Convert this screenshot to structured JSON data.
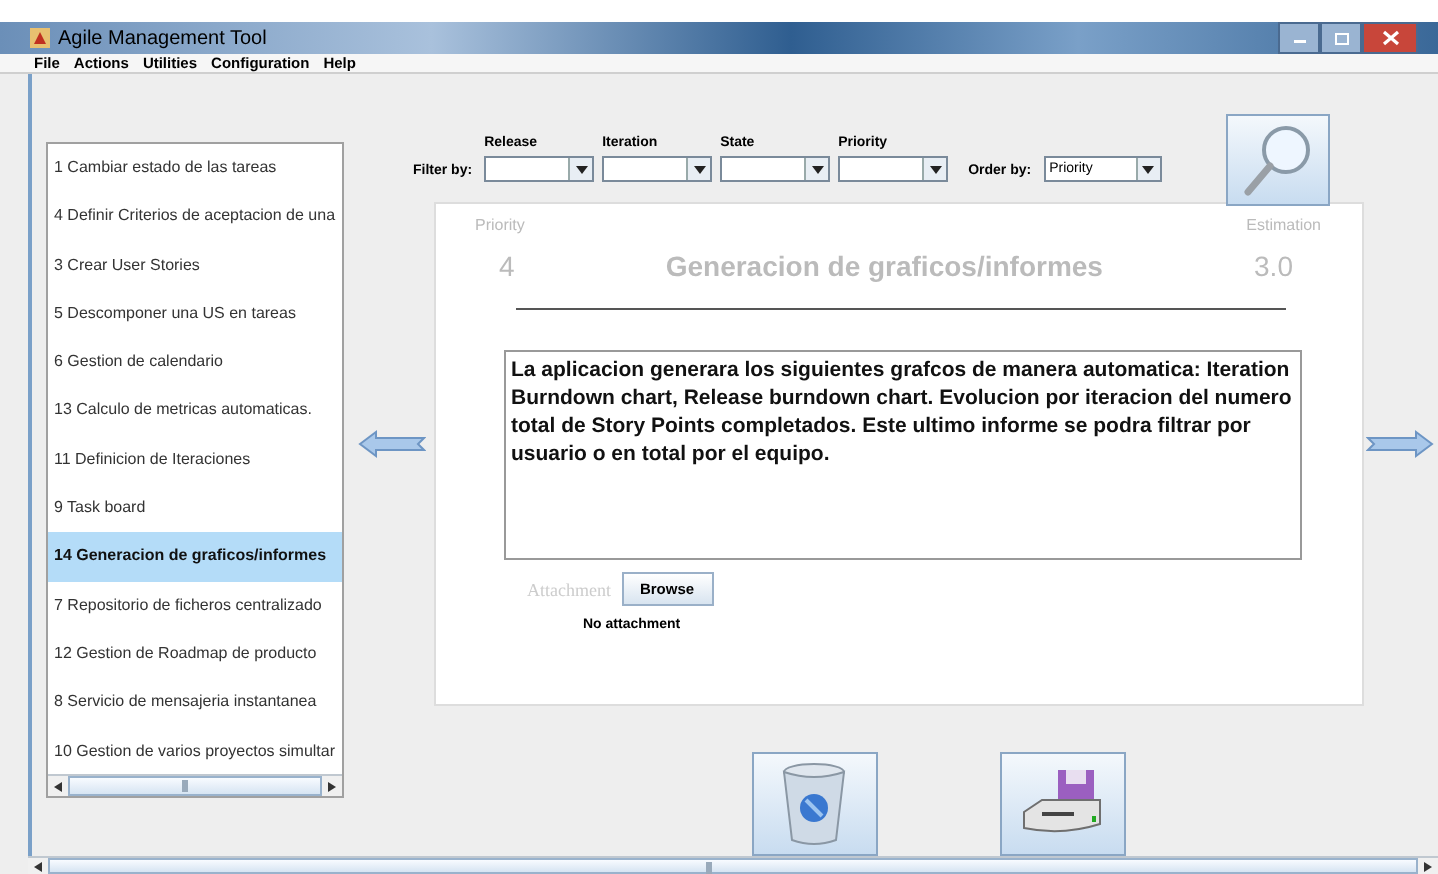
{
  "window": {
    "title": "Agile Management Tool"
  },
  "menu": [
    "File",
    "Actions",
    "Utilities",
    "Configuration",
    "Help"
  ],
  "filter": {
    "label": "Filter by:",
    "combos": [
      {
        "label": "Release"
      },
      {
        "label": "Iteration"
      },
      {
        "label": "State"
      },
      {
        "label": "Priority"
      }
    ],
    "order_label": "Order by:",
    "order_value": "Priority"
  },
  "stories": [
    {
      "label": "1  Cambiar estado de las tareas",
      "selected": false
    },
    {
      "label": "4  Definir Criterios de aceptacion de una",
      "selected": false
    },
    {
      "label": "3  Crear User Stories",
      "selected": false
    },
    {
      "label": "5  Descomponer una US en tareas",
      "selected": false
    },
    {
      "label": "6  Gestion de calendario",
      "selected": false
    },
    {
      "label": "13  Calculo de metricas automaticas.",
      "selected": false
    },
    {
      "label": "11  Definicion de Iteraciones",
      "selected": false
    },
    {
      "label": "9  Task board",
      "selected": false
    },
    {
      "label": "14  Generacion de graficos/informes",
      "selected": true
    },
    {
      "label": "7  Repositorio de ficheros centralizado",
      "selected": false
    },
    {
      "label": "12  Gestion de Roadmap de producto",
      "selected": false
    },
    {
      "label": "8  Servicio de mensajeria instantanea",
      "selected": false
    },
    {
      "label": "10  Gestion de varios proyectos simultar",
      "selected": false
    }
  ],
  "detail": {
    "priority_label": "Priority",
    "priority": "4",
    "title": "Generacion de graficos/informes",
    "estimation_label": "Estimation",
    "estimation": "3.0",
    "description": "La aplicacion generara los siguientes grafcos de manera automatica: Iteration Burndown chart, Release burndown chart. Evolucion por iteracion del numero total de Story Points completados. Este ultimo informe se podra filtrar por usuario o en total por el equipo.",
    "attachment_label": "Attachment",
    "browse_button": "Browse",
    "attachment_status": "No attachment"
  }
}
